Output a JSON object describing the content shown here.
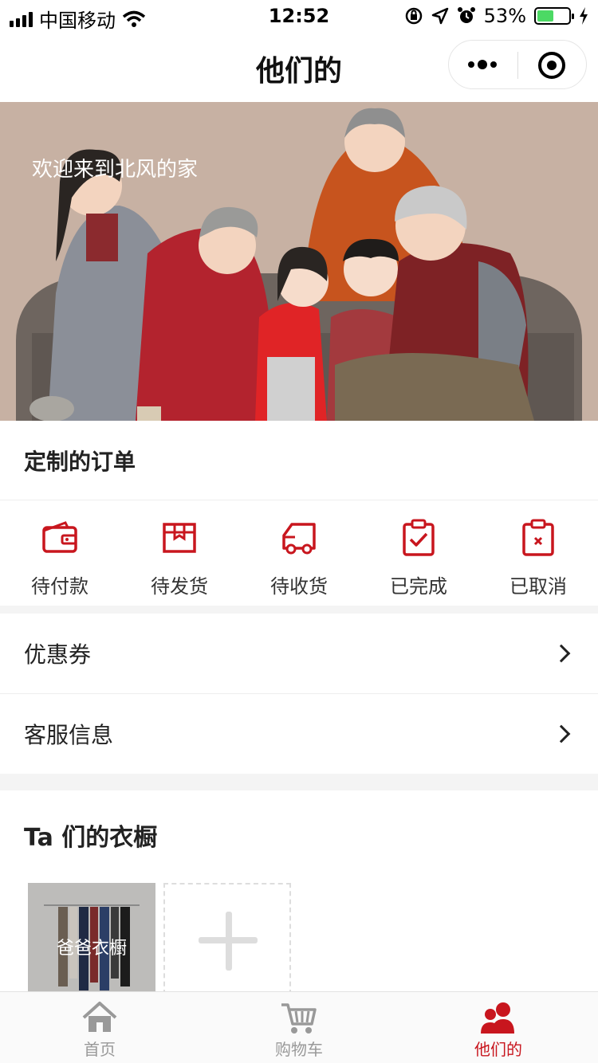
{
  "status_bar": {
    "carrier": "中国移动",
    "time": "12:52",
    "battery": "53%",
    "battery_level": 0.53
  },
  "nav": {
    "title": "他们的"
  },
  "banner": {
    "welcome": "欢迎来到北风的家"
  },
  "orders": {
    "title": "定制的订单",
    "items": [
      {
        "label": "待付款",
        "icon": "wallet-icon"
      },
      {
        "label": "待发货",
        "icon": "package-icon"
      },
      {
        "label": "待收货",
        "icon": "truck-icon"
      },
      {
        "label": "已完成",
        "icon": "clipboard-check-icon"
      },
      {
        "label": "已取消",
        "icon": "clipboard-x-icon"
      }
    ]
  },
  "menu": {
    "items": [
      {
        "label": "优惠券"
      },
      {
        "label": "客服信息"
      }
    ]
  },
  "wardrobe": {
    "title": "Ta 们的衣橱",
    "cards": [
      {
        "label": "爸爸衣橱"
      }
    ]
  },
  "tabbar": {
    "items": [
      {
        "label": "首页",
        "icon": "home-icon",
        "active": false
      },
      {
        "label": "购物车",
        "icon": "cart-icon",
        "active": false
      },
      {
        "label": "他们的",
        "icon": "users-icon",
        "active": true
      }
    ]
  },
  "colors": {
    "accent": "#c8161e",
    "inactive": "#999999"
  }
}
